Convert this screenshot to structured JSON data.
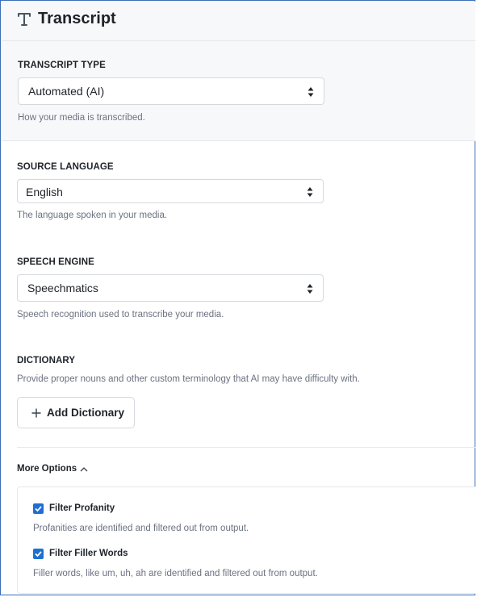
{
  "header": {
    "title": "Transcript",
    "icon": "text-t-icon"
  },
  "transcript_type": {
    "label": "TRANSCRIPT TYPE",
    "value": "Automated (AI)",
    "help": "How your media is transcribed."
  },
  "source_language": {
    "label": "SOURCE LANGUAGE",
    "value": "English",
    "help": "The language spoken in your media."
  },
  "speech_engine": {
    "label": "SPEECH ENGINE",
    "value": "Speechmatics",
    "help": "Speech recognition used to transcribe your media."
  },
  "dictionary": {
    "label": "DICTIONARY",
    "help": "Provide proper nouns and other custom terminology that AI may have difficulty with.",
    "add_button": "Add Dictionary"
  },
  "more_options": {
    "label": "More Options",
    "expanded": true,
    "options": [
      {
        "label": "Filter Profanity",
        "checked": true,
        "help": "Profanities are identified and filtered out from output."
      },
      {
        "label": "Filter Filler Words",
        "checked": true,
        "help": "Filler words, like um, uh, ah are identified and filtered out from output."
      }
    ]
  },
  "colors": {
    "accent": "#1f6fd1",
    "panel_bg": "#f7f8fa",
    "border": "#d5d9de",
    "muted_text": "#6b7280"
  }
}
